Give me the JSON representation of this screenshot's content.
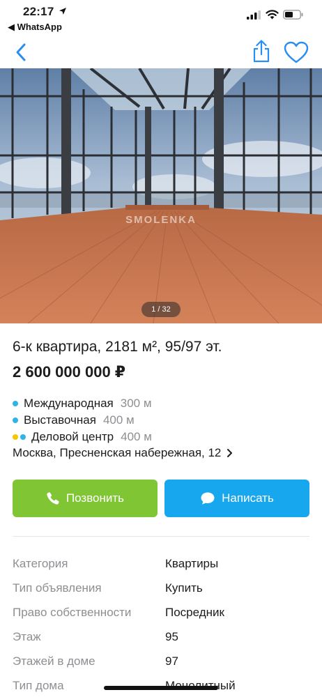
{
  "status_bar": {
    "time": "22:17",
    "back_app": "◀ WhatsApp"
  },
  "nav": {
    "back_icon": "chevron-left-icon",
    "share_icon": "share-icon",
    "favorite_icon": "heart-icon"
  },
  "gallery": {
    "watermark": "SMOLENKA",
    "counter": "1 / 32"
  },
  "listing": {
    "title": "6-к квартира, 2181 м², 95/97 эт.",
    "price": "2 600 000 000 ₽",
    "metro": [
      {
        "name": "Международная",
        "distance": "300 м",
        "colors": [
          "#2fb4e6"
        ]
      },
      {
        "name": "Выставочная",
        "distance": "400 м",
        "colors": [
          "#2fb4e6"
        ]
      },
      {
        "name": "Деловой центр",
        "distance": "400 м",
        "colors": [
          "#f6c700",
          "#2fb4e6"
        ]
      }
    ],
    "address": "Москва, Пресненская набережная, 12"
  },
  "actions": {
    "call_label": "Позвонить",
    "message_label": "Написать",
    "call_color": "#80c634",
    "message_color": "#17a7ef"
  },
  "params": [
    {
      "label": "Категория",
      "value": "Квартиры"
    },
    {
      "label": "Тип объявления",
      "value": "Купить"
    },
    {
      "label": "Право собственности",
      "value": "Посредник"
    },
    {
      "label": "Этаж",
      "value": "95"
    },
    {
      "label": "Этажей в доме",
      "value": "97"
    },
    {
      "label": "Тип дома",
      "value": "Монолитный"
    }
  ],
  "colors": {
    "accent": "#2a8ef0",
    "muted_text": "#8e8e93"
  }
}
